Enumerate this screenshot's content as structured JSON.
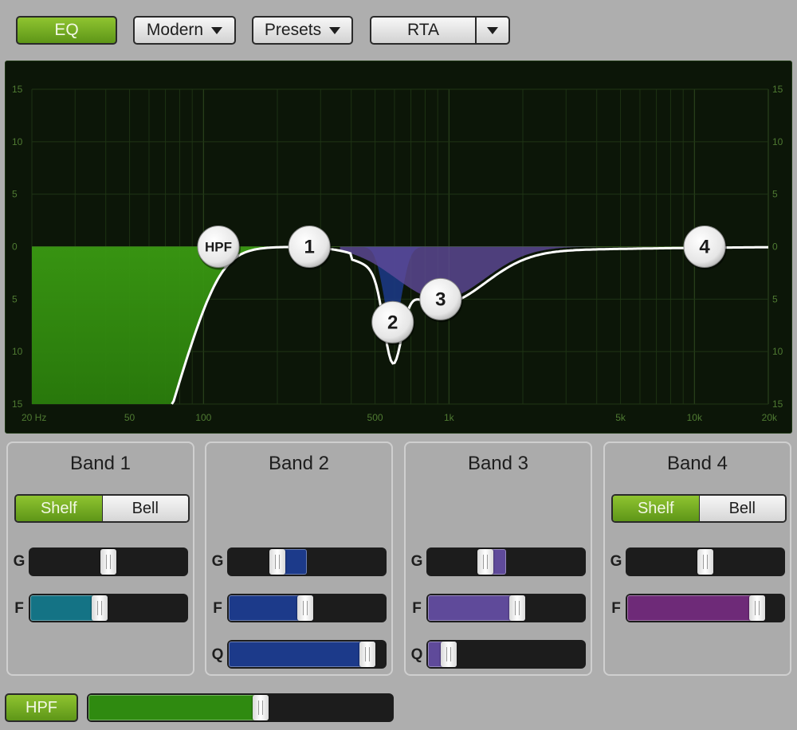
{
  "toolbar": {
    "eq_label": "EQ",
    "mode_label": "Modern",
    "presets_label": "Presets",
    "rta_label": "RTA"
  },
  "graph": {
    "db_labels_left": [
      "15",
      "10",
      "5",
      "0",
      "5",
      "10",
      "15"
    ],
    "db_labels_right": [
      "15",
      "10",
      "5",
      "0",
      "5",
      "10",
      "15"
    ],
    "freq_labels": [
      {
        "text": "20 Hz",
        "hz": 20
      },
      {
        "text": "50",
        "hz": 50
      },
      {
        "text": "100",
        "hz": 100
      },
      {
        "text": "500",
        "hz": 500
      },
      {
        "text": "1k",
        "hz": 1000
      },
      {
        "text": "5k",
        "hz": 5000
      },
      {
        "text": "10k",
        "hz": 10000
      },
      {
        "text": "20k",
        "hz": 20000
      }
    ],
    "db_range": [
      -15,
      15
    ],
    "freq_range": [
      20,
      20000
    ],
    "curve_color": "#ffffff",
    "nodes": [
      {
        "label": "HPF",
        "hz": 115,
        "db": 0
      },
      {
        "label": "1",
        "hz": 270,
        "db": 0
      },
      {
        "label": "2",
        "hz": 590,
        "db": -7.2
      },
      {
        "label": "3",
        "hz": 925,
        "db": -5
      },
      {
        "label": "4",
        "hz": 11000,
        "db": 0
      }
    ]
  },
  "colors": {
    "accent_green": "#6aa61c",
    "band1_teal": "#147385",
    "band2_blue": "#1c3a8a",
    "band3_purple": "#5f4a9a",
    "band4_magenta": "#6e2a78",
    "hpf_green": "#2f8a10"
  },
  "bands": [
    {
      "title": "Band 1",
      "shelf_label": "Shelf",
      "bell_label": "Bell",
      "mode": "Shelf",
      "g_label": "G",
      "f_label": "F",
      "gain": 0.5,
      "freq": 0.44
    },
    {
      "title": "Band 2",
      "g_label": "G",
      "f_label": "F",
      "q_label": "Q",
      "gain": 0.29,
      "freq": 0.49,
      "q": 0.93
    },
    {
      "title": "Band 3",
      "g_label": "G",
      "f_label": "F",
      "q_label": "Q",
      "gain": 0.35,
      "freq": 0.58,
      "q": 0.09
    },
    {
      "title": "Band 4",
      "shelf_label": "Shelf",
      "bell_label": "Bell",
      "mode": "Shelf",
      "g_label": "G",
      "f_label": "F",
      "gain": 0.5,
      "freq": 0.87
    }
  ],
  "hpf": {
    "label": "HPF",
    "freq": 0.57
  }
}
